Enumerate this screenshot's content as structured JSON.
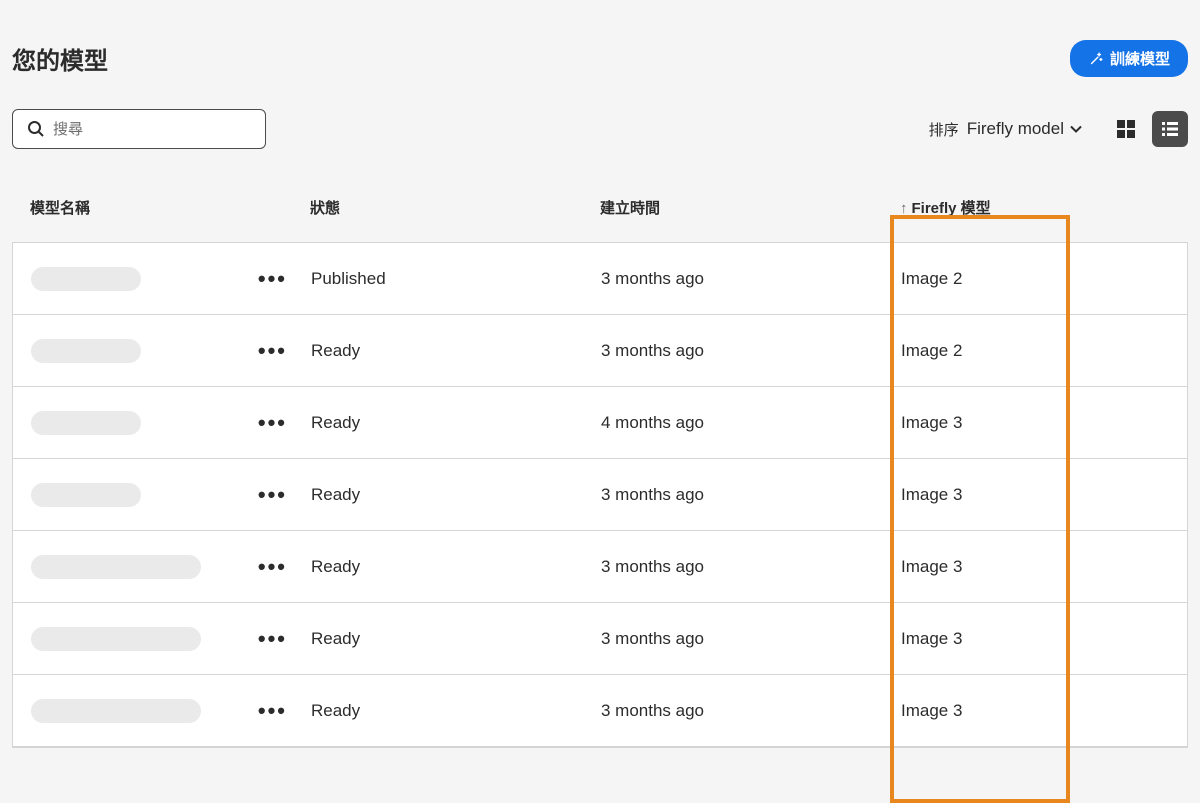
{
  "header": {
    "title": "您的模型",
    "train_button_label": "訓練模型"
  },
  "search": {
    "placeholder": "搜尋"
  },
  "sort": {
    "label": "排序",
    "selected": "Firefly model"
  },
  "columns": {
    "name": "模型名稱",
    "status": "狀態",
    "created": "建立時間",
    "firefly": "Firefly 模型"
  },
  "rows": [
    {
      "pill_w": 110,
      "status": "Published",
      "created": "3 months ago",
      "firefly": "Image 2"
    },
    {
      "pill_w": 110,
      "status": "Ready",
      "created": "3 months ago",
      "firefly": "Image 2"
    },
    {
      "pill_w": 110,
      "status": "Ready",
      "created": "4 months ago",
      "firefly": "Image 3"
    },
    {
      "pill_w": 110,
      "status": "Ready",
      "created": "3 months ago",
      "firefly": "Image 3"
    },
    {
      "pill_w": 170,
      "status": "Ready",
      "created": "3 months ago",
      "firefly": "Image 3"
    },
    {
      "pill_w": 170,
      "status": "Ready",
      "created": "3 months ago",
      "firefly": "Image 3"
    },
    {
      "pill_w": 170,
      "status": "Ready",
      "created": "3 months ago",
      "firefly": "Image 3"
    }
  ]
}
